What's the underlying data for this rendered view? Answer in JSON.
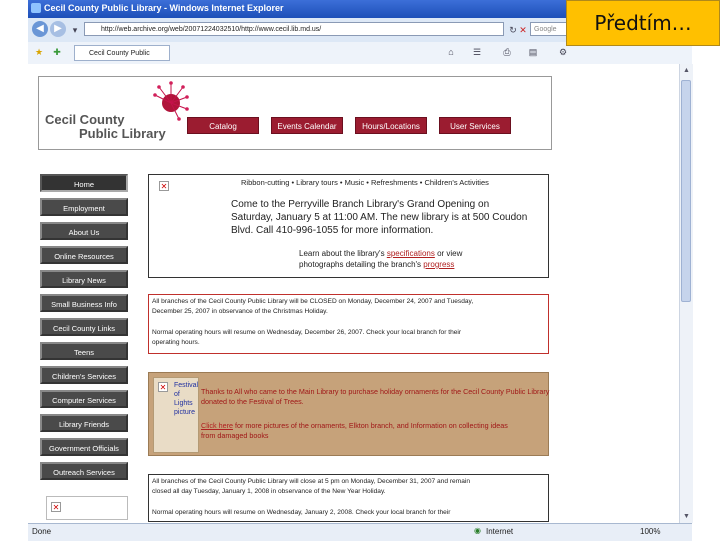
{
  "window": {
    "title": "Cecil County Public Library - Windows Internet Explorer",
    "url": "http://web.archive.org/web/20071224032510/http://www.cecil.lib.md.us/",
    "search_placeholder": "Google",
    "tab_label": "Cecil County Public Library",
    "status_left": "Done",
    "status_zone": "Internet",
    "zoom": "100%"
  },
  "badge": {
    "label": "Předtím…"
  },
  "banner": {
    "logo_line1": "Cecil County",
    "logo_line2": "Public Library",
    "nav": [
      "Catalog",
      "Events Calendar",
      "Hours/Locations",
      "User Services"
    ]
  },
  "leftnav": [
    "Home",
    "Employment",
    "About Us",
    "Online Resources",
    "Library News",
    "Small Business Info",
    "Cecil County Links",
    "Teens",
    "Children's Services",
    "Computer Services",
    "Library Friends",
    "Government Officials",
    "Outreach Services"
  ],
  "boxes": {
    "perryville": {
      "top": "Ribbon-cutting • Library tours • Music • Refreshments • Children's Activities",
      "line1": "Come to the Perryville Branch Library's Grand Opening on",
      "line2": "Saturday, January 5 at 11:00 AM. The new library is at 500 Coudon",
      "line3": "Blvd. Call 410-996-1055 for more information.",
      "line4a": "Learn about the library's ",
      "link1": "specifications",
      "line4b": " or view",
      "line5a": "photographs detailing the branch's ",
      "link2": "progress"
    },
    "christmas": {
      "p1a": "All branches of the Cecil County Public Library will be CLOSED on Monday, December 24, 2007 and Tuesday,",
      "p1b": "December 25, 2007 in observance of the Christmas Holiday.",
      "p2a": "Normal operating hours will resume on Wednesday, December 26, 2007. Check your local branch for their",
      "p2b": "operating hours."
    },
    "festival": {
      "img_alt_1": "Festival",
      "img_alt_2": "of",
      "img_alt_3": "Lights",
      "img_alt_4": "picture",
      "line1": "Thanks to All who came to the Main Library to purchase holiday ornaments for the Cecil County Public Library",
      "line2": "donated to the Festival of Trees.",
      "link": "Click here",
      "line3": " for more pictures of the ornaments, Elkton branch, and Information on collecting ideas",
      "line4": "from damaged books"
    },
    "newyear": {
      "p1a": "All branches of the Cecil County Public Library will close at 5 pm on Monday, December 31, 2007 and remain",
      "p1b": "closed all day Tuesday, January 1, 2008 in observance of the New Year Holiday.",
      "p2": "Normal operating hours will resume on Wednesday, January 2, 2008. Check your local branch for their"
    }
  },
  "colors": {
    "nav_red": "#9b1c30",
    "badge": "#ffc000",
    "leftnav": "#4a4a4a",
    "tan": "#c6a27a"
  }
}
